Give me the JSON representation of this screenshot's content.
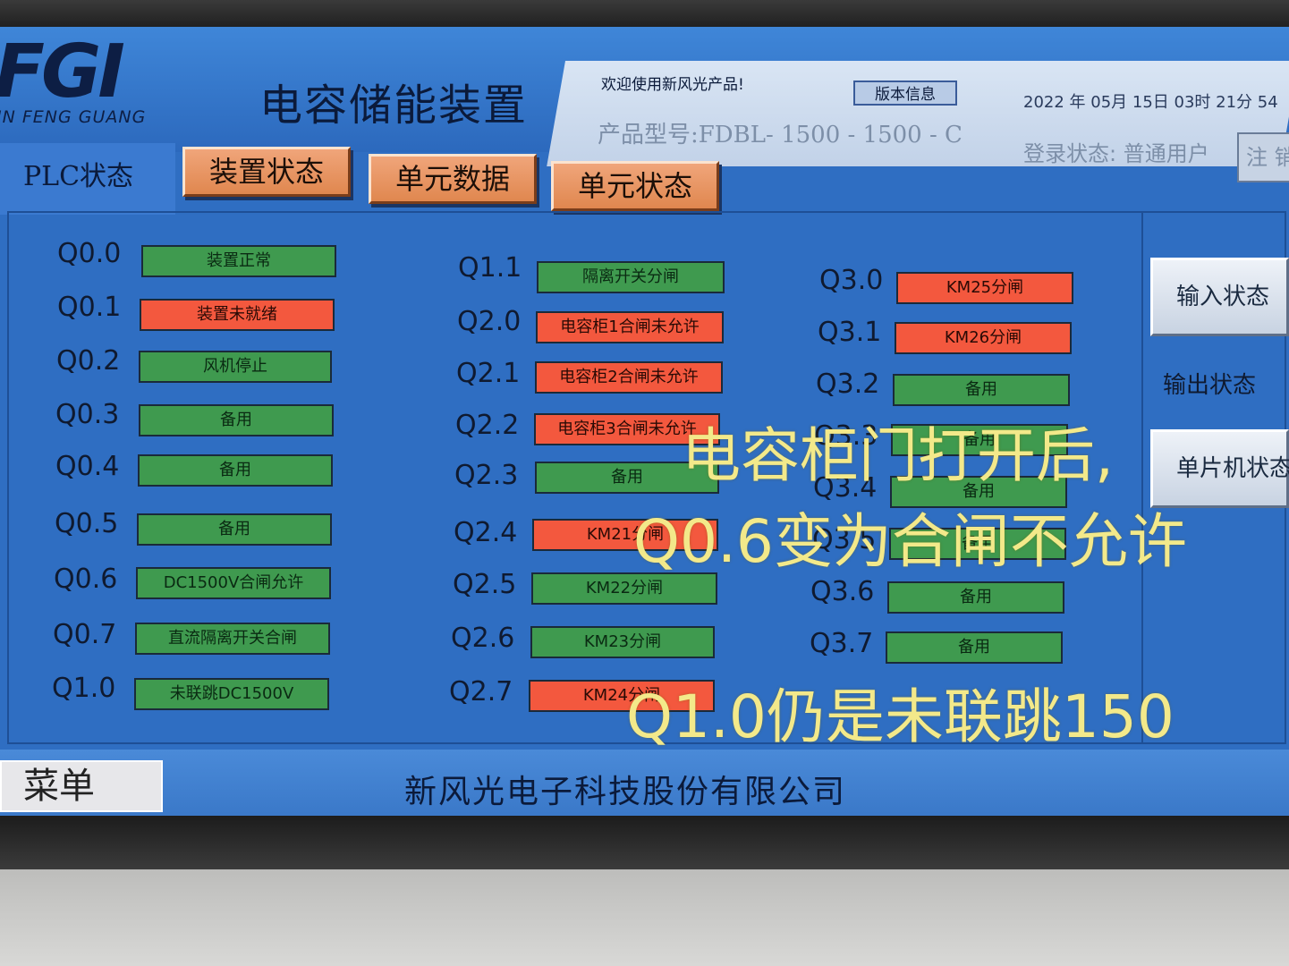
{
  "header": {
    "logo_text": "FGI",
    "logo_subtext": "IN FENG GUANG",
    "title": "电容储能装置",
    "welcome": "欢迎使用新风光产品!",
    "version_button": "版本信息",
    "datetime": "2022 年 05月 15日 03时 21分 54",
    "model": "产品型号:FDBL-  1500  -  1500  - C",
    "login_status": "登录状态: 普通用户",
    "logout_button": "注 销"
  },
  "tabs": {
    "plc": "PLC状态",
    "device_status": "装置状态",
    "unit_data": "单元数据",
    "unit_status": "单元状态"
  },
  "outputs": {
    "col1": [
      {
        "id": "Q0.0",
        "text": "装置正常",
        "state": "green"
      },
      {
        "id": "Q0.1",
        "text": "装置未就绪",
        "state": "red"
      },
      {
        "id": "Q0.2",
        "text": "风机停止",
        "state": "green"
      },
      {
        "id": "Q0.3",
        "text": "备用",
        "state": "green"
      },
      {
        "id": "Q0.4",
        "text": "备用",
        "state": "green"
      },
      {
        "id": "Q0.5",
        "text": "备用",
        "state": "green"
      },
      {
        "id": "Q0.6",
        "text": "DC1500V合闸允许",
        "state": "green"
      },
      {
        "id": "Q0.7",
        "text": "直流隔离开关合闸",
        "state": "green"
      },
      {
        "id": "Q1.0",
        "text": "未联跳DC1500V",
        "state": "green"
      }
    ],
    "col2": [
      {
        "id": "Q1.1",
        "text": "隔离开关分闸",
        "state": "green"
      },
      {
        "id": "Q2.0",
        "text": "电容柜1合闸未允许",
        "state": "red"
      },
      {
        "id": "Q2.1",
        "text": "电容柜2合闸未允许",
        "state": "red"
      },
      {
        "id": "Q2.2",
        "text": "电容柜3合闸未允许",
        "state": "red"
      },
      {
        "id": "Q2.3",
        "text": "备用",
        "state": "green"
      },
      {
        "id": "Q2.4",
        "text": "KM21分闸",
        "state": "red"
      },
      {
        "id": "Q2.5",
        "text": "KM22分闸",
        "state": "green"
      },
      {
        "id": "Q2.6",
        "text": "KM23分闸",
        "state": "green"
      },
      {
        "id": "Q2.7",
        "text": "KM24分闸",
        "state": "red"
      }
    ],
    "col3": [
      {
        "id": "Q3.0",
        "text": "KM25分闸",
        "state": "red"
      },
      {
        "id": "Q3.1",
        "text": "KM26分闸",
        "state": "red"
      },
      {
        "id": "Q3.2",
        "text": "备用",
        "state": "green"
      },
      {
        "id": "Q3.3",
        "text": "备用",
        "state": "green"
      },
      {
        "id": "Q3.4",
        "text": "备用",
        "state": "green"
      },
      {
        "id": "Q3.5",
        "text": "备用",
        "state": "green"
      },
      {
        "id": "Q3.6",
        "text": "备用",
        "state": "green"
      },
      {
        "id": "Q3.7",
        "text": "备用",
        "state": "green"
      }
    ]
  },
  "side": {
    "input_status": "输入状态",
    "output_status": "输出状态",
    "mcu_status": "单片机状态"
  },
  "footer": {
    "menu": "菜单",
    "company": "新风光电子科技股份有限公司"
  },
  "annotation": {
    "line1": "电容柜门打开后,",
    "line2": "Q0.6变为合闸不允许",
    "line3": "Q1.0仍是未联跳150"
  },
  "colors": {
    "on_green": "#3f9a4f",
    "alarm_red": "#f3583e",
    "tab_orange": "#e8945f",
    "screen_blue": "#2f6ec2"
  }
}
